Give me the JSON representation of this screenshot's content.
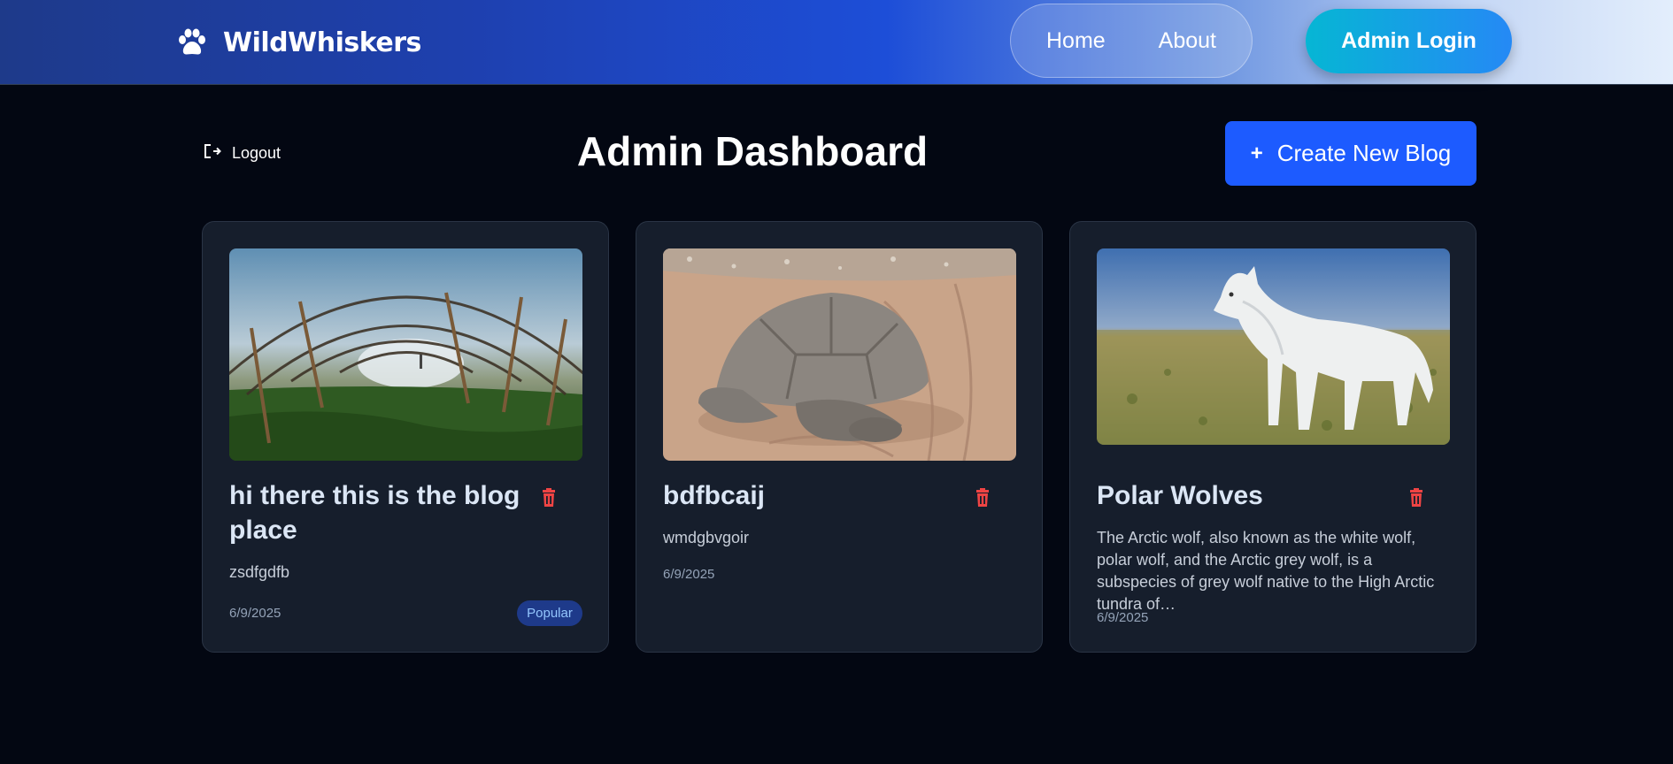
{
  "navbar": {
    "brand": "WildWhiskers",
    "brand_icon": "paw-icon",
    "links": [
      "Home",
      "About"
    ],
    "login_label": "Admin Login"
  },
  "header": {
    "logout_label": "Logout",
    "title": "Admin Dashboard",
    "create_label": "Create New Blog",
    "create_icon": "plus-icon"
  },
  "posts": [
    {
      "title": "hi there this is the blog place",
      "excerpt": "zsdfgdfb",
      "date": "6/9/2025",
      "badge": "Popular",
      "image": "greenhouse-photo"
    },
    {
      "title": "bdfbcaij",
      "excerpt": "wmdgbvgoir",
      "date": "6/9/2025",
      "image": "tortoise-photo"
    },
    {
      "title": "Polar Wolves",
      "excerpt": "The Arctic wolf, also known as the white wolf, polar wolf, and the Arctic grey wolf, is a subspecies of grey wolf native to the High Arctic tundra of…",
      "date": "6/9/2025",
      "image": "arctic-wolf-photo"
    }
  ],
  "colors": {
    "background": "#030712",
    "card": "#161e2c",
    "primary_button": "#1d5bff",
    "delete_icon": "#ef4444",
    "badge_bg": "#1e3a8a",
    "badge_text": "#93c5fd"
  }
}
